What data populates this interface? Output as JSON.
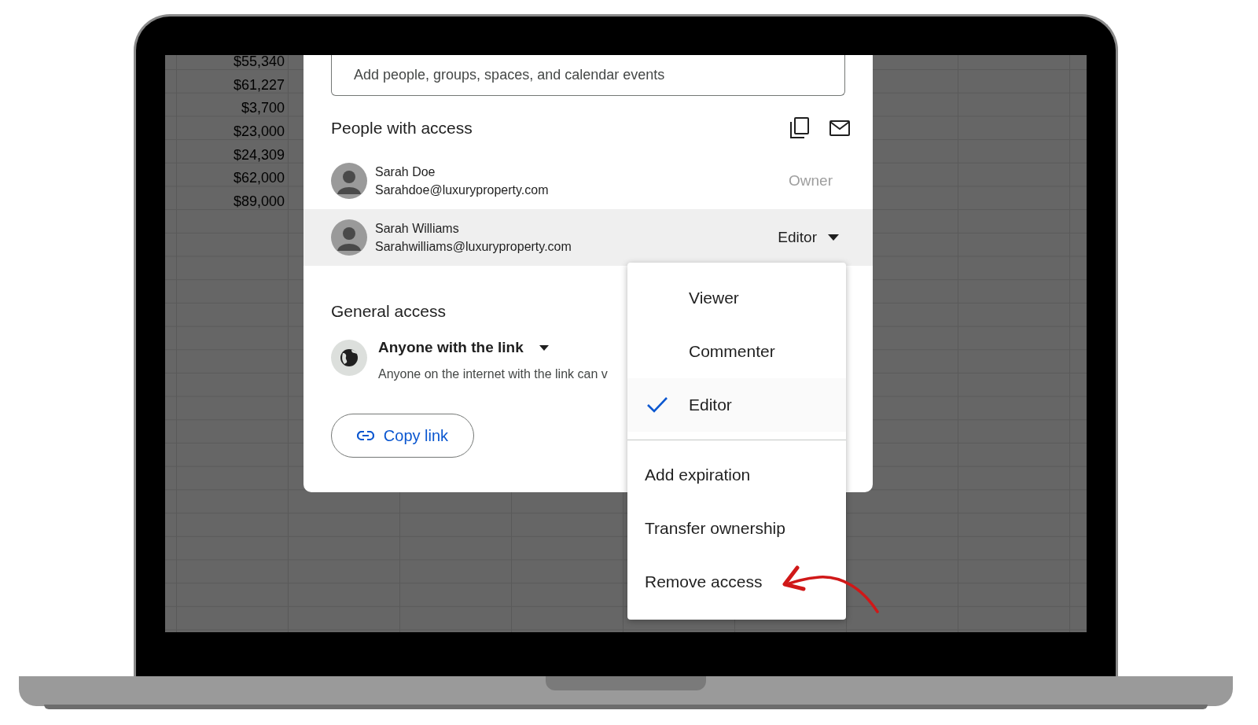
{
  "spreadsheet": {
    "column_values": [
      "$55,340",
      "$61,227",
      "$3,700",
      "$23,000",
      "$24,309",
      "$62,000",
      "$89,000"
    ]
  },
  "share_dialog": {
    "add_field": {
      "placeholder": "Add people, groups, spaces, and calendar events"
    },
    "people_heading": "People with access",
    "people": [
      {
        "name": "Sarah Doe",
        "email": "Sarahdoe@luxuryproperty.com",
        "role": "Owner",
        "has_menu": false,
        "highlighted": false
      },
      {
        "name": "Sarah Williams",
        "email": "Sarahwilliams@luxuryproperty.com",
        "role": "Editor",
        "has_menu": true,
        "highlighted": true
      }
    ],
    "general_access_heading": "General access",
    "link_setting": "Anyone with the link",
    "link_description": "Anyone on the internet with the link can v",
    "copy_link": "Copy link"
  },
  "role_menu": {
    "items": [
      {
        "kind": "role",
        "label": "Viewer",
        "selected": false
      },
      {
        "kind": "role",
        "label": "Commenter",
        "selected": false
      },
      {
        "kind": "role",
        "label": "Editor",
        "selected": true
      },
      {
        "kind": "action",
        "label": "Add expiration"
      },
      {
        "kind": "action",
        "label": "Transfer ownership"
      },
      {
        "kind": "action",
        "label": "Remove access"
      }
    ]
  }
}
